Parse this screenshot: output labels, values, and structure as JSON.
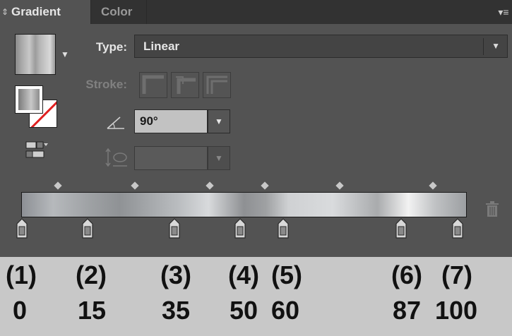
{
  "tabs": [
    {
      "label": "Gradient",
      "active": true
    },
    {
      "label": "Color",
      "active": false
    }
  ],
  "type": {
    "label": "Type:",
    "value": "Linear"
  },
  "stroke": {
    "label": "Stroke:",
    "enabled": false
  },
  "angle": {
    "value": "90°"
  },
  "aspect_ratio": {
    "value": "",
    "enabled": false
  },
  "gradient_stops": [
    0,
    15,
    35,
    50,
    60,
    87,
    100
  ],
  "annotations": [
    {
      "label": "(1)",
      "value": "0"
    },
    {
      "label": "(2)",
      "value": "15"
    },
    {
      "label": "(3)",
      "value": "35"
    },
    {
      "label": "(4)",
      "value": "50"
    },
    {
      "label": "(5)",
      "value": "60"
    },
    {
      "label": "(6)",
      "value": "87"
    },
    {
      "label": "(7)",
      "value": "100"
    }
  ],
  "colors": {
    "panel_bg": "#535353",
    "tabbar_bg": "#323232",
    "caption_bg": "#c8c8c8",
    "none_slash": "#e02020"
  },
  "icons": [
    "collapse-icon",
    "panel-menu-icon",
    "reverse-gradient-icon",
    "angle-icon",
    "aspect-ratio-icon",
    "trash-icon"
  ]
}
